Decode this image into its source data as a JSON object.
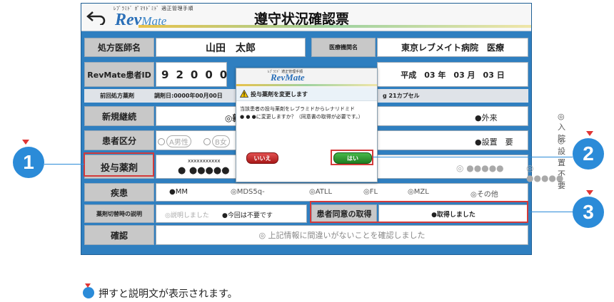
{
  "header": {
    "logo_small": "ﾚﾌﾞﾗﾐﾄﾞ ﾎﾟﾏﾘﾄﾞﾐﾄﾞ 適正管理手順",
    "logo_main": "Rev",
    "logo_sub": "Mate",
    "title": "遵守状況確認票"
  },
  "form": {
    "doctor_label": "処方医師名",
    "doctor_value": "山田　太郎",
    "facility_label": "医療機関名",
    "facility_value": "東京レブメイト病院　医療",
    "patient_id_label": "RevMate患者ID",
    "patient_id_digits": [
      "9",
      "2",
      "0",
      "0",
      "0"
    ],
    "date_value": "平成　03 年　03 月　03 日",
    "prev_label": "前回処方薬剤",
    "prev_value": "調剤日:0000年00月00日",
    "prev_tail": "g 21カプセル",
    "continuation_label": "新規継続",
    "continuation_new": "◎新規",
    "outpatient": "●外来",
    "inpatient": "◎入院",
    "category_label": "患者区分",
    "category_a": "A男性",
    "category_b": "B女",
    "setting_required": "●設置　要",
    "setting_not_required": "◎設置不要",
    "drug_label": "投与薬剤",
    "drug_value_small": "xxxxxxxxxxx",
    "drug_value_mask": "● ●●●●●",
    "drug_opt_a": "◎ ●●●●●",
    "drug_opt_b": "◎ ●●●●●",
    "disease_label": "疾患",
    "disease_options": [
      "●MM",
      "◎MDS5q-",
      "◎ATLL",
      "◎FL",
      "◎MZL",
      "◎その他"
    ],
    "explain_label": "薬剤切替時の説明",
    "explain_done": "◎説明しました",
    "explain_not_needed": "●今回は不要です",
    "consent_label": "患者同意の取得",
    "consent_value": "●取得しました",
    "confirm_label": "確認",
    "confirm_value": "◎ 上記情報に間違いがないことを確認しました"
  },
  "dialog": {
    "logo_small": "ﾚﾌﾞﾗﾐﾄﾞ 適正管理手順",
    "logo": "RevMate",
    "title": "投与薬剤を変更します",
    "body_line1": "当該患者の投与薬剤をレブラミドからレナリドミド",
    "body_line2": "● ● ●に変更しますか？（同意書の取得が必要です。）",
    "no_label": "いいえ",
    "yes_label": "はい"
  },
  "callouts": [
    "1",
    "2",
    "3"
  ],
  "legend": "押すと説明文が表示されます。",
  "colors": {
    "accent": "#2b8bd8",
    "highlight": "#d43a3a",
    "marker": "#e03535"
  }
}
